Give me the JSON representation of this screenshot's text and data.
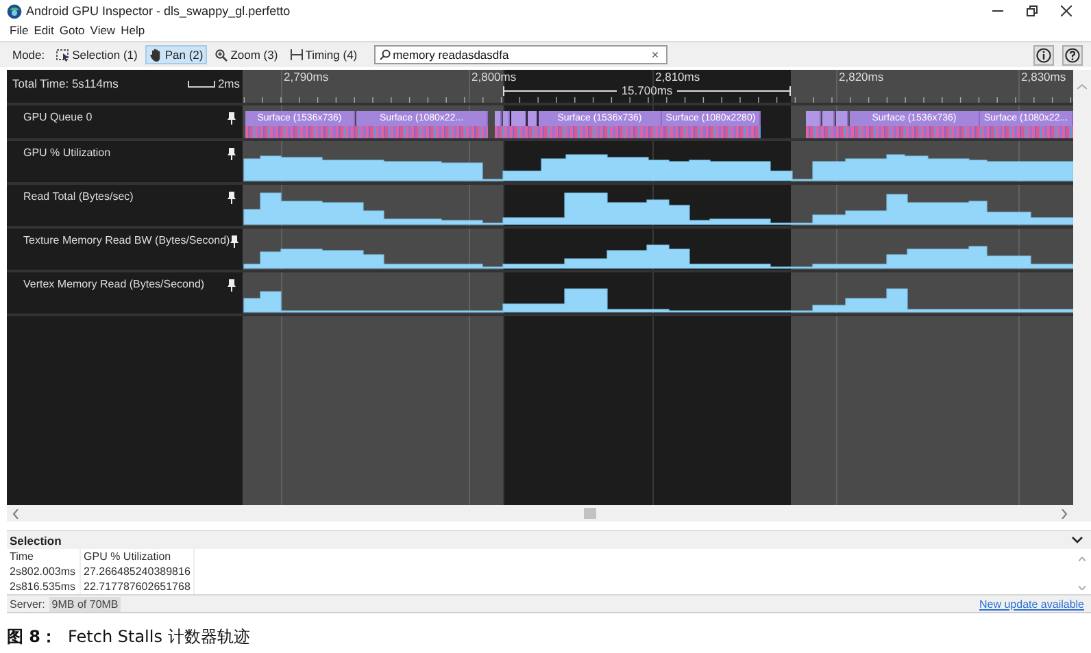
{
  "window": {
    "title": "Android GPU Inspector - dls_swappy_gl.perfetto"
  },
  "menu": [
    "File",
    "Edit",
    "Goto",
    "View",
    "Help"
  ],
  "toolbar": {
    "mode_label": "Mode:",
    "modes": [
      {
        "label": "Selection (1)",
        "kind": "selection",
        "selected": false
      },
      {
        "label": "Pan (2)",
        "kind": "pan",
        "selected": true
      },
      {
        "label": "Zoom (3)",
        "kind": "zoom",
        "selected": false
      },
      {
        "label": "Timing (4)",
        "kind": "timing",
        "selected": false
      }
    ],
    "search": {
      "value": "memory readasdasdfa",
      "clear": "×"
    }
  },
  "timeline": {
    "total_time": "Total Time: 5s114ms",
    "scale": "2ms",
    "ticks": [
      "2,790ms",
      "2,800ms",
      "2,810ms",
      "2,820ms",
      "2,830ms"
    ],
    "measurement": "15.700ms",
    "tracks": [
      {
        "name": "GPU Queue 0",
        "kind": "queue",
        "slices": [
          "Surface (1536x736)",
          "Surface (1080x22...",
          "Surface (1536x736)",
          "Surface (1080x2280)",
          "Surface (1536x736)",
          "Surface (1080x22..."
        ]
      },
      {
        "name": "GPU % Utilization",
        "kind": "counter"
      },
      {
        "name": "Read Total (Bytes/sec)",
        "kind": "counter"
      },
      {
        "name": "Texture Memory Read BW (Bytes/Second)",
        "kind": "counter"
      },
      {
        "name": "Vertex Memory Read (Bytes/Second)",
        "kind": "counter"
      }
    ]
  },
  "selection": {
    "title": "Selection",
    "columns": [
      "Time",
      "GPU % Utilization"
    ],
    "rows": [
      [
        "2s802.003ms",
        "27.266485240389816"
      ],
      [
        "2s816.535ms",
        "22.717787602651768"
      ]
    ]
  },
  "status_bar": {
    "server_label": "Server:",
    "memory": "9MB of 70MB",
    "update_link": "New update available"
  },
  "caption": {
    "label": "图 8：",
    "text": "Fetch Stalls 计数器轨迹"
  }
}
